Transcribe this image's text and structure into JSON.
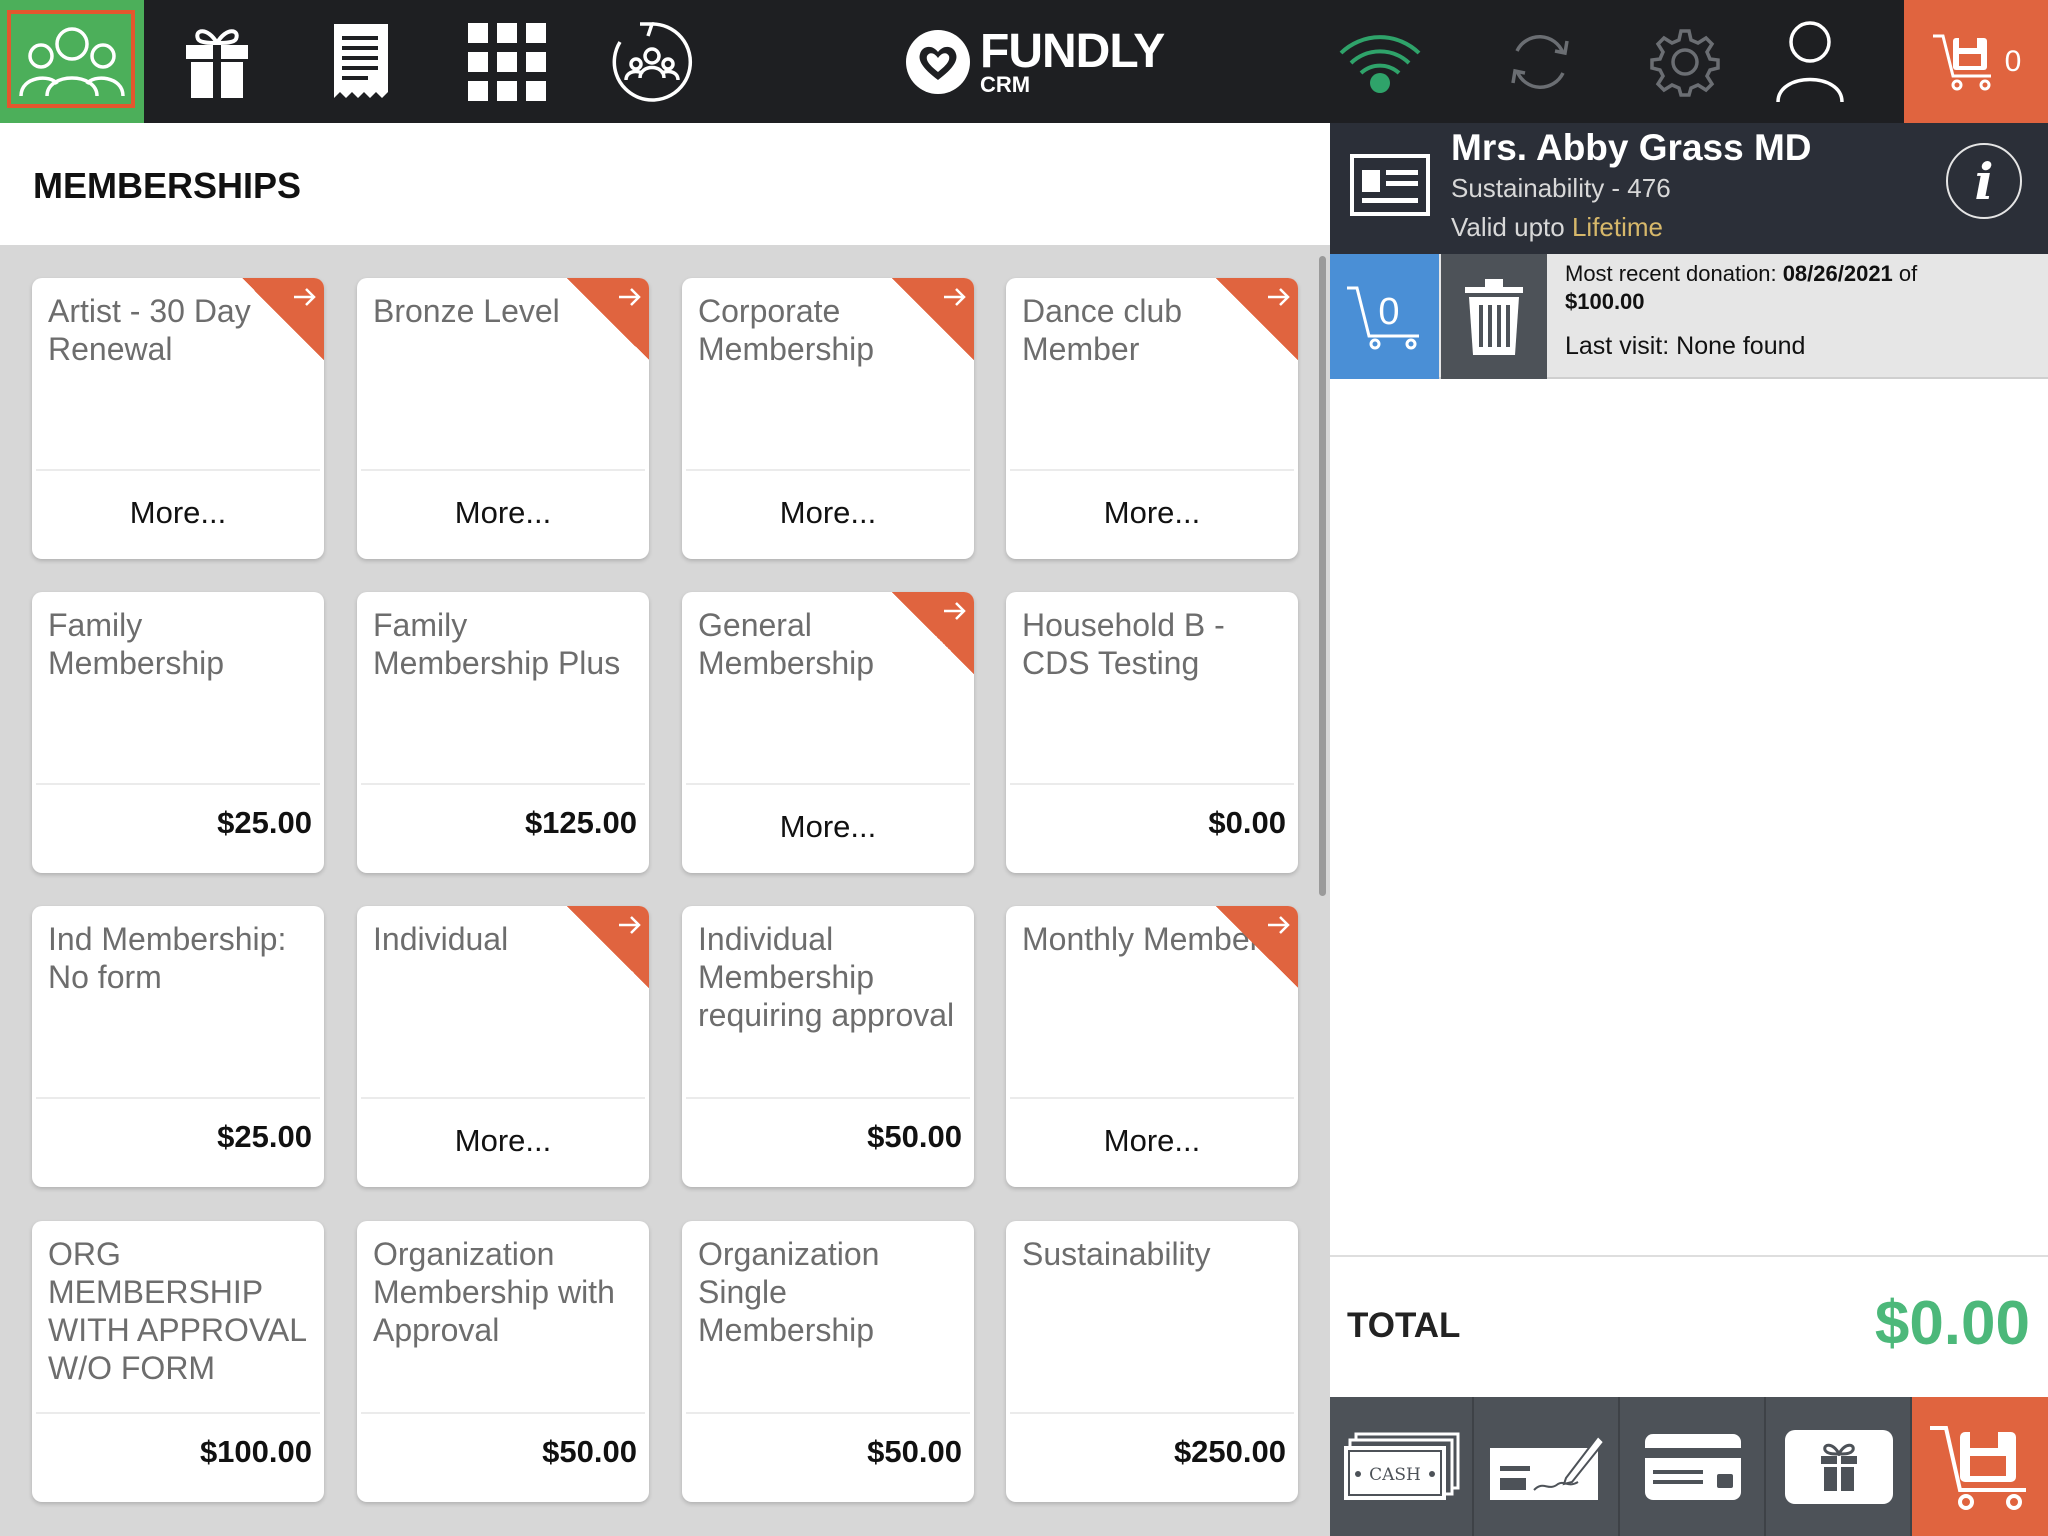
{
  "brand": {
    "name": "FUNDLY",
    "sub": "CRM"
  },
  "topbar": {
    "cart_count": "0"
  },
  "section_title": "MEMBERSHIPS",
  "customer": {
    "name": "Mrs. Abby Grass MD",
    "subtitle": "Sustainability - 476",
    "valid_prefix": "Valid upto",
    "valid_value": "Lifetime"
  },
  "actions": {
    "cart_count": "0",
    "recent_prefix": "Most recent donation: ",
    "recent_date": "08/26/2021",
    "recent_of": " of",
    "recent_amount": "$100.00",
    "last_visit": "Last visit: None found"
  },
  "total": {
    "label": "TOTAL",
    "value": "$0.00"
  },
  "payments": {
    "cash_label": "CASH"
  },
  "memberships": [
    {
      "name": "Artist - 30 Day Renewal",
      "footer": "More...",
      "kind": "more",
      "flag": true
    },
    {
      "name": "Bronze Level",
      "footer": "More...",
      "kind": "more",
      "flag": true
    },
    {
      "name": "Corporate Membership",
      "footer": "More...",
      "kind": "more",
      "flag": true
    },
    {
      "name": "Dance club Member",
      "footer": "More...",
      "kind": "more",
      "flag": true
    },
    {
      "name": "Family Membership",
      "footer": "$25.00",
      "kind": "price",
      "flag": false
    },
    {
      "name": "Family Membership Plus",
      "footer": "$125.00",
      "kind": "price",
      "flag": false
    },
    {
      "name": "General Membership",
      "footer": "More...",
      "kind": "more",
      "flag": true
    },
    {
      "name": "Household B - CDS Testing",
      "footer": "$0.00",
      "kind": "price",
      "flag": false
    },
    {
      "name": "Ind Membership: No form",
      "footer": "$25.00",
      "kind": "price",
      "flag": false
    },
    {
      "name": "Individual",
      "footer": "More...",
      "kind": "more",
      "flag": true
    },
    {
      "name": "Individual Membership requiring approval",
      "footer": "$50.00",
      "kind": "price",
      "flag": false
    },
    {
      "name": "Monthly Member",
      "footer": "More...",
      "kind": "more",
      "flag": true
    },
    {
      "name": "ORG MEMBERSHIP WITH APPROVAL W/O FORM",
      "footer": "$100.00",
      "kind": "price",
      "flag": false
    },
    {
      "name": "Organization Membership with Approval",
      "footer": "$50.00",
      "kind": "price",
      "flag": false
    },
    {
      "name": "Organization Single Membership",
      "footer": "$50.00",
      "kind": "price",
      "flag": false
    },
    {
      "name": "Sustainability",
      "footer": "$250.00",
      "kind": "price",
      "flag": false
    }
  ]
}
